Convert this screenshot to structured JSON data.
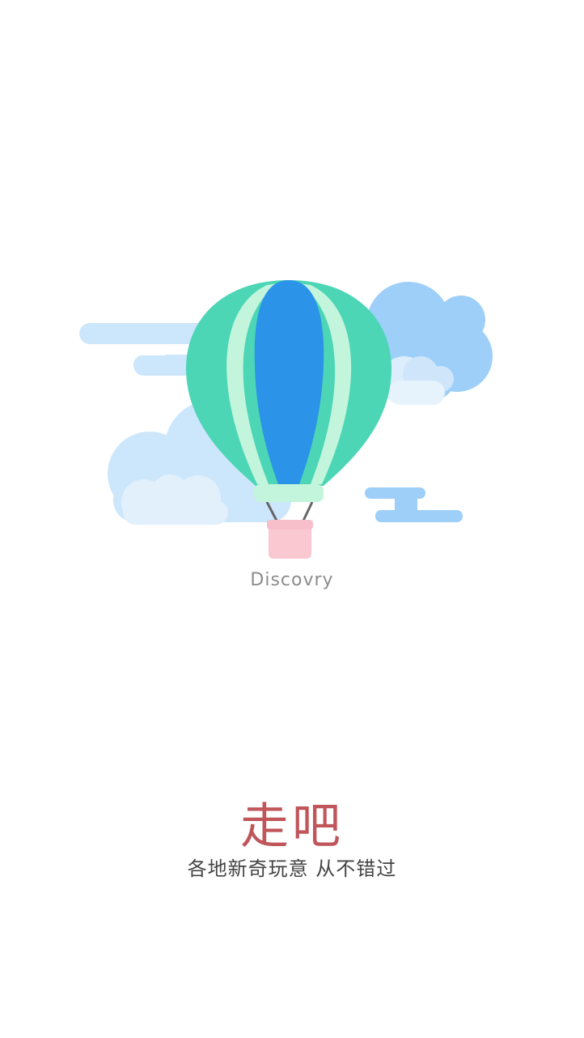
{
  "splash": {
    "illustration_icon": "hot-air-balloon-icon",
    "brand_word": "Discovry",
    "headline": "走吧",
    "tagline": "各地新奇玩意  从不错过"
  },
  "colors": {
    "background": "#ffffff",
    "balloon_green": "#4cd6b5",
    "balloon_blue": "#2b93e8",
    "balloon_stripe": "#c2f5dc",
    "basket_pink": "#f9c8d0",
    "cloud_light": "#cce6fb",
    "cloud_blue": "#9dcff8",
    "headline_red": "#c0555a",
    "tagline_gray": "#444444",
    "brand_gray": "#8c8c8c"
  }
}
